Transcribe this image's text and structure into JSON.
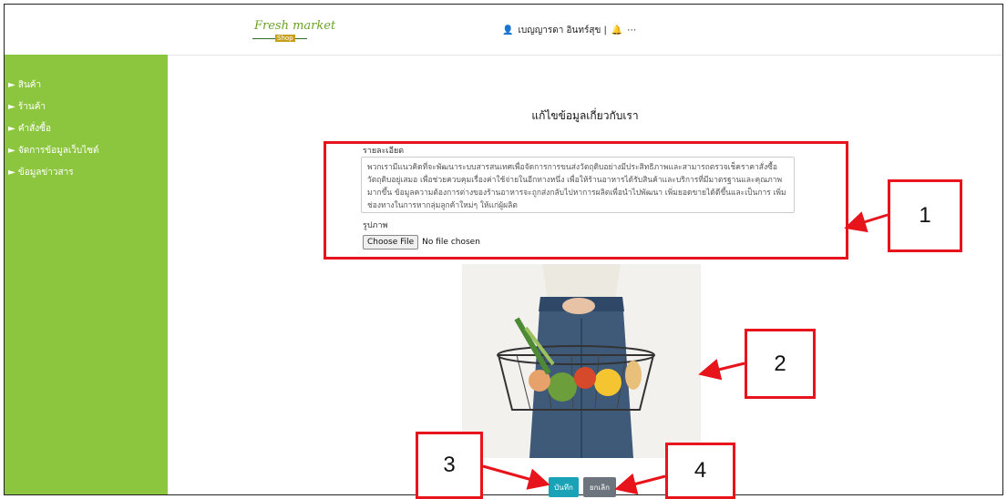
{
  "header": {
    "logo_text": "Fresh market",
    "logo_sub": "Shop",
    "user_name": "เบญญารดา อินทร์สุข |"
  },
  "sidebar": {
    "items": [
      {
        "label": "► สินค้า"
      },
      {
        "label": "► ร้านค้า"
      },
      {
        "label": "► คำสั่งซื้อ"
      },
      {
        "label": "► จัดการข้อมูลเว็บไซต์"
      },
      {
        "label": "► ข้อมูลข่าวสาร"
      }
    ]
  },
  "main": {
    "title": "แก้ไขข้อมูลเกี่ยวกับเรา",
    "detail_label": "รายละเอียด",
    "detail_value": "พวกเรามีแนวคิดที่จะพัฒนาระบบสารสนเทศเพื่อจัดการการขนส่งวัตถุดิบอย่างมีประสิทธิภาพและสามารถตรวจเช็คราคาสั่งซื้อ วัตถุดิบอยู่เสมอ เพื่อช่วยควบคุมเรื่องค่าใช้จ่ายในอีกทางหนึ่ง เพื่อให้ร้านอาหารได้รับสินค้าและบริการที่มีมาตรฐานและคุณภาพ มากขึ้น ข้อมูลความต้องการต่างของร้านอาหารจะถูกส่งกลับไปหาการผลิตเพื่อนำไปพัฒนา เพิ่มยอดขายได้ดีขึ้นและเป็นการ เพิ่มช่องทางในการหากลุ่มลูกค้าใหม่ๆ ให้แก่ผู้ผลิต",
    "image_label": "รูปภาพ",
    "file_button": "Choose File",
    "file_status": "No file chosen",
    "save_label": "บันทึก",
    "cancel_label": "ยกเลิก"
  },
  "annotations": {
    "labels": [
      "1",
      "2",
      "3",
      "4"
    ],
    "color": "#e8141b"
  }
}
